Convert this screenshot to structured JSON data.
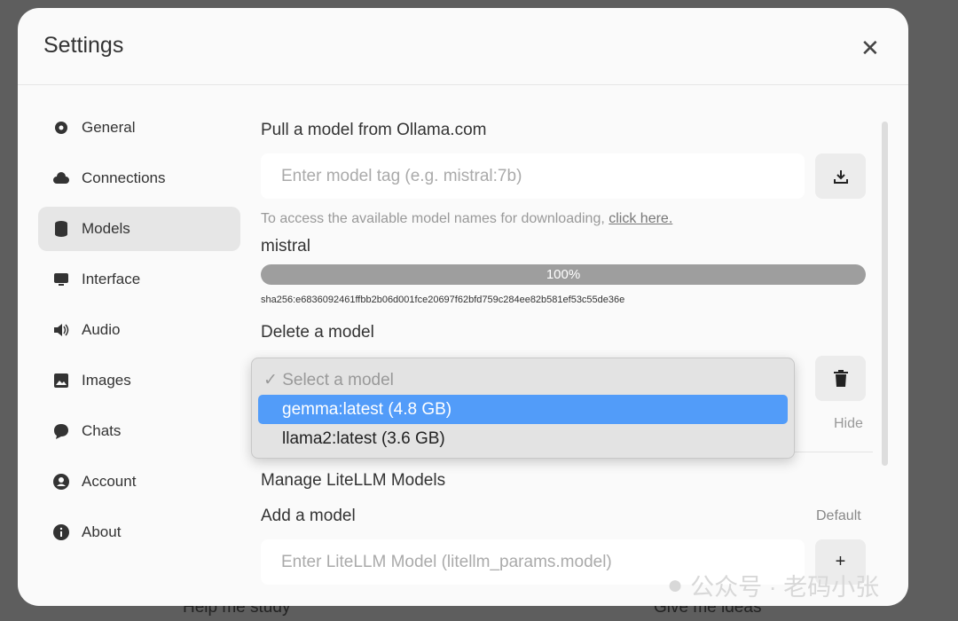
{
  "background": {
    "left_text": "Help me study",
    "right_text": "Give me ideas"
  },
  "modal": {
    "title": "Settings",
    "close_icon": "close-icon"
  },
  "sidebar": {
    "items": [
      {
        "label": "General",
        "icon": "gear-icon"
      },
      {
        "label": "Connections",
        "icon": "cloud-icon"
      },
      {
        "label": "Models",
        "icon": "database-icon",
        "selected": true
      },
      {
        "label": "Interface",
        "icon": "monitor-icon"
      },
      {
        "label": "Audio",
        "icon": "speaker-icon"
      },
      {
        "label": "Images",
        "icon": "image-icon"
      },
      {
        "label": "Chats",
        "icon": "chat-bubble-icon"
      },
      {
        "label": "Account",
        "icon": "user-circle-icon"
      },
      {
        "label": "About",
        "icon": "info-icon"
      }
    ]
  },
  "pull": {
    "heading": "Pull a model from Ollama.com",
    "placeholder": "Enter model tag (e.g. mistral:7b)",
    "hint": "To access the available model names for downloading,",
    "hint_link": "click here.",
    "model_name": "mistral",
    "progress_label": "100%",
    "progress_percent": 100,
    "digest": "sha256:e6836092461ffbb2b06d001fce20697f62bfd759c284ee82b581ef53c55de36e"
  },
  "delete": {
    "heading": "Delete a model",
    "options": [
      "Select a model",
      "gemma:latest (4.8 GB)",
      "llama2:latest (3.6 GB)"
    ],
    "highlighted": "gemma:latest (4.8 GB)",
    "hide_label": "Hide"
  },
  "litellm": {
    "heading": "Manage LiteLLM Models",
    "add_heading": "Add a model",
    "default_label": "Default",
    "placeholder": "Enter LiteLLM Model (litellm_params.model)",
    "add_button": "+"
  },
  "watermark": "公众号 · 老码小张",
  "colors": {
    "highlight": "#529cf9",
    "progress": "#9e9e9e"
  }
}
